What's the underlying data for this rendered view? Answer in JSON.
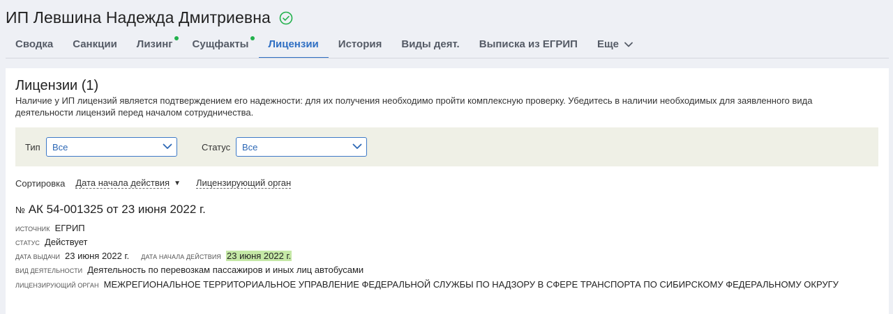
{
  "header": {
    "title": "ИП Левшина Надежда Дмитриевна",
    "tabs": [
      {
        "label": "Сводка",
        "dot": false,
        "active": false
      },
      {
        "label": "Санкции",
        "dot": false,
        "active": false
      },
      {
        "label": "Лизинг",
        "dot": true,
        "active": false
      },
      {
        "label": "Сущфакты",
        "dot": true,
        "active": false
      },
      {
        "label": "Лицензии",
        "dot": false,
        "active": true
      },
      {
        "label": "История",
        "dot": false,
        "active": false
      },
      {
        "label": "Виды деят.",
        "dot": false,
        "active": false
      },
      {
        "label": "Выписка из ЕГРИП",
        "dot": false,
        "active": false
      },
      {
        "label": "Еще",
        "dot": false,
        "active": false
      }
    ]
  },
  "section": {
    "title": "Лицензии (1)",
    "description": "Наличие у ИП лицензий является подтверждением его надежности: для их получения необходимо пройти комплексную проверку. Убедитесь в наличии необходимых для заявленного вида деятельности лицензий перед началом сотрудничества."
  },
  "filters": {
    "type_label": "Тип",
    "type_value": "Все",
    "status_label": "Статус",
    "status_value": "Все"
  },
  "sort": {
    "label": "Сортировка",
    "by_date": "Дата начала действия",
    "by_authority": "Лицензирующий орган"
  },
  "license": {
    "no_sign": "№",
    "title": "АК 54-001325 от 23 июня 2022 г.",
    "source_label": "источник",
    "source": "ЕГРИП",
    "status_label": "статус",
    "status": "Действует",
    "issue_label": "дата выдачи",
    "issue_date": "23 июня 2022 г.",
    "start_label": "дата начала действия",
    "start_date": "23 июня 2022 г.",
    "activity_label": "вид деятельности",
    "activity": "Деятельность по перевозкам пассажиров и иных лиц автобусами",
    "authority_label": "лицензирующий орган",
    "authority": "МЕЖРЕГИОНАЛЬНОЕ ТЕРРИТОРИАЛЬНОЕ УПРАВЛЕНИЕ ФЕДЕРАЛЬНОЙ СЛУЖБЫ ПО НАДЗОРУ В СФЕРЕ ТРАНСПОРТА ПО СИБИРСКОМУ ФЕДЕРАЛЬНОМУ ОКРУГУ"
  },
  "colors": {
    "accent": "#2f6fc3",
    "dot": "#22b14c",
    "highlight": "#c5e8a6",
    "filter_bg": "#eff0e6"
  }
}
